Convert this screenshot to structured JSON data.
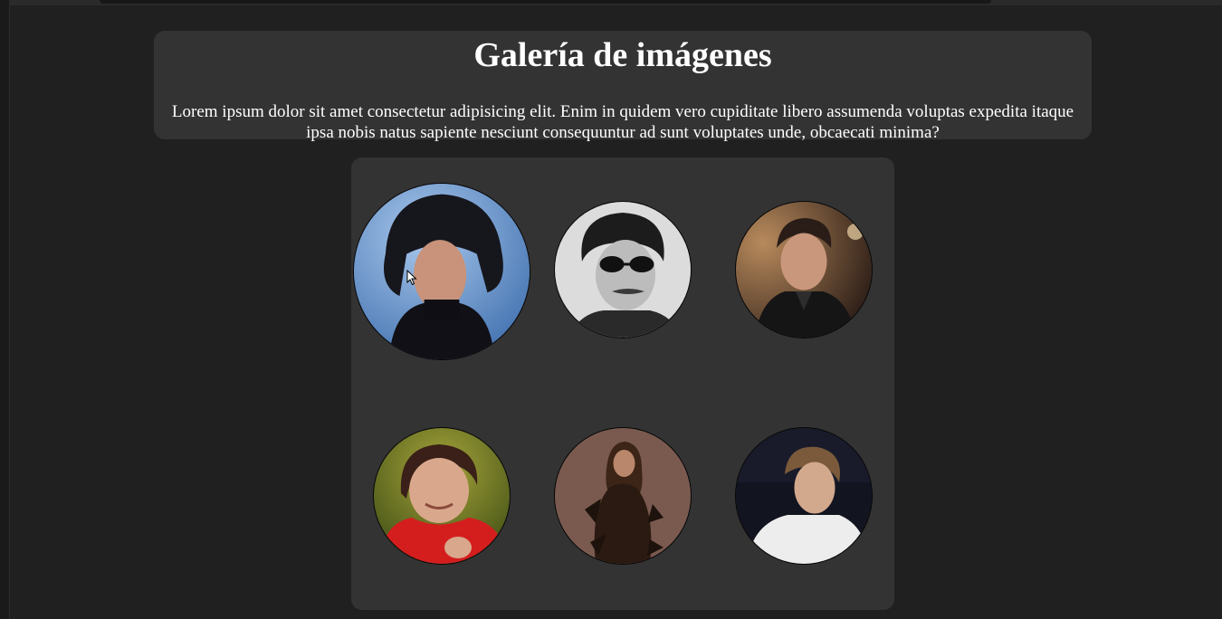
{
  "header": {
    "title": "Galería de imágenes",
    "description": "Lorem ipsum dolor sit amet consectetur adipisicing elit. Enim in quidem vero cupiditate libero assumenda voluptas expedita itaque ipsa nobis natus sapiente nesciunt consequuntur ad sunt voluptates unde, obcaecati minima?"
  },
  "gallery": {
    "images": [
      {
        "name": "portrait-1",
        "state": "hovered",
        "colors": {
          "background": "#5b8fd0",
          "hair": "#1a1a22",
          "skin": "#c8937a",
          "clothing": "#111118"
        }
      },
      {
        "name": "portrait-2",
        "state": "default",
        "colors": {
          "background": "#d8d8d8",
          "hair": "#1c1c1c",
          "skin": "#b7b7b7",
          "clothing": "#2a2a2a"
        }
      },
      {
        "name": "portrait-3",
        "state": "default",
        "colors": {
          "background": "#5a4030",
          "hair": "#2a1d18",
          "skin": "#c9977c",
          "clothing": "#141414"
        }
      },
      {
        "name": "portrait-4",
        "state": "default",
        "colors": {
          "background": "#6a7a1c",
          "hair": "#3a2018",
          "skin": "#d9a88c",
          "clothing": "#d41e1e"
        }
      },
      {
        "name": "portrait-5",
        "state": "default",
        "colors": {
          "background": "#7a5a4f",
          "hair": "#3c2416",
          "skin": "#b9876c",
          "clothing": "#2a1a12"
        }
      },
      {
        "name": "portrait-6",
        "state": "default",
        "colors": {
          "background": "#121420",
          "hair": "#7a5a3a",
          "skin": "#d2a98c",
          "clothing": "#eeeeee"
        }
      }
    ]
  },
  "cursor": {
    "type": "arrow-pointer"
  }
}
